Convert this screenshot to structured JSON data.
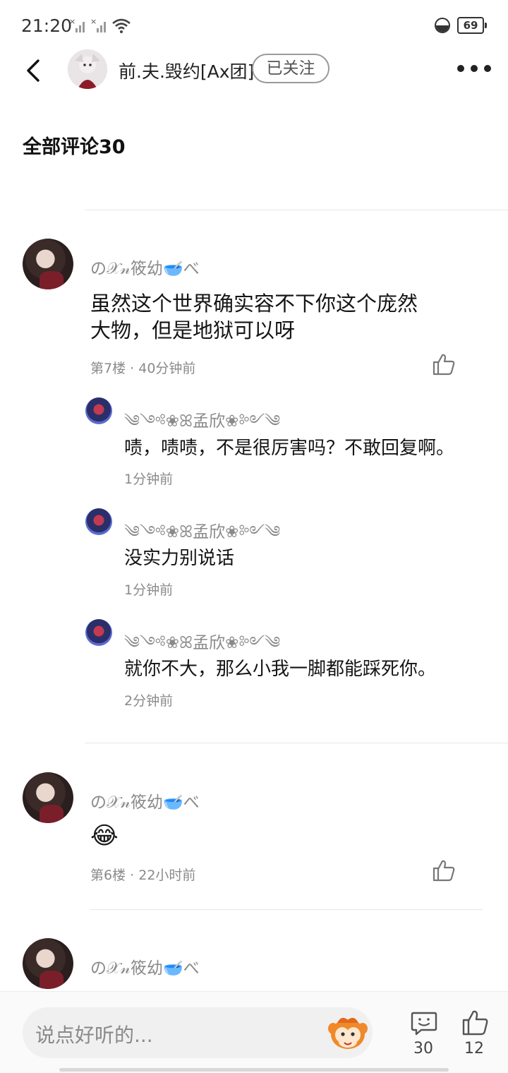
{
  "status_bar": {
    "time": "21:20",
    "battery": "69"
  },
  "header": {
    "username": "前.夫.毁约[Ax团]",
    "follow_label": "已关注"
  },
  "section_title": "全部评论30",
  "comments": [
    {
      "username": "の𝒳𝓃筱幼🥣べ",
      "text_line1": "虽然这个世界确实容不下你这个庞然",
      "text_line2": "大物，但是地狱可以呀",
      "floor": "第7楼",
      "time": "40分钟前",
      "replies": [
        {
          "username": "༄༺❀ꕤ孟欣❀༻༄",
          "text": "啧，啧啧，不是很厉害吗？不敢回复啊。",
          "time": "1分钟前"
        },
        {
          "username": "༄༺❀ꕤ孟欣❀༻༄",
          "text": "没实力别说话",
          "time": "1分钟前"
        },
        {
          "username": "༄༺❀ꕤ孟欣❀༻༄",
          "text": "就你不大，那么小我一脚都能踩死你。",
          "time": "2分钟前"
        }
      ]
    },
    {
      "username": "の𝒳𝓃筱幼🥣べ",
      "text": "😂",
      "floor": "第6楼",
      "time": "22小时前"
    },
    {
      "username": "の𝒳𝓃筱幼🥣べ"
    }
  ],
  "meta_separator": "·",
  "bottom_bar": {
    "input_placeholder": "说点好听的...",
    "comment_count": "30",
    "like_count": "12"
  },
  "icons": {
    "back": "back-arrow-icon",
    "more": "more-dots-icon",
    "like": "thumbs-up-icon",
    "comment": "comment-bubble-icon",
    "mascot": "monkey-mascot-icon"
  }
}
